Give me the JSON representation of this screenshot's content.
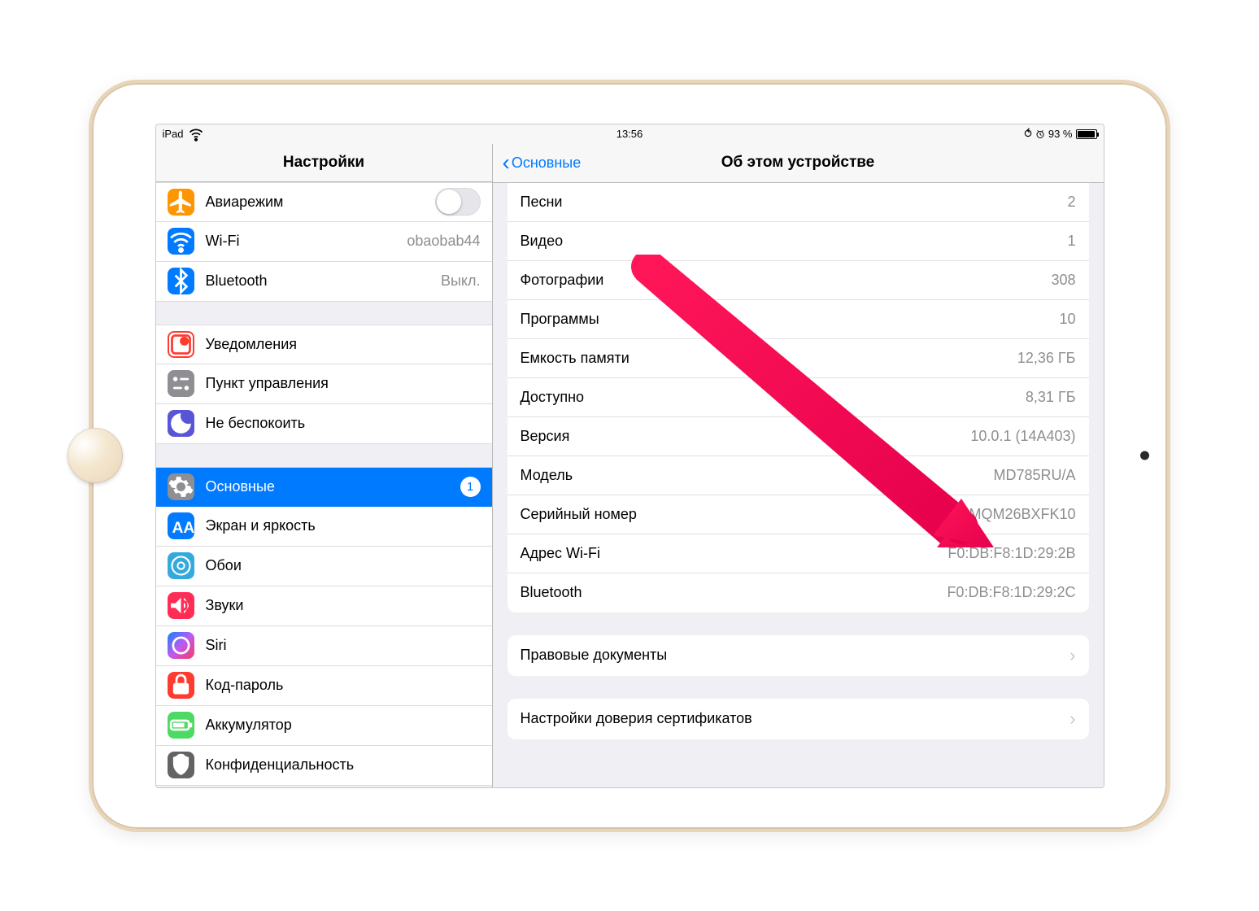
{
  "status": {
    "carrier": "iPad",
    "time": "13:56",
    "battery_text": "93 %",
    "lock_icon": "⟳",
    "alarm_icon": "●"
  },
  "sidebar": {
    "title": "Настройки",
    "groups": [
      [
        {
          "id": "airplane",
          "label": "Авиарежим",
          "icon_bg": "bg-orange",
          "has_toggle": true
        },
        {
          "id": "wifi",
          "label": "Wi-Fi",
          "value": "obaobab44",
          "icon_bg": "bg-blue"
        },
        {
          "id": "bluetooth",
          "label": "Bluetooth",
          "value": "Выкл.",
          "icon_bg": "bg-blue"
        }
      ],
      [
        {
          "id": "notifications",
          "label": "Уведомления",
          "icon_bg": "bg-white-outline"
        },
        {
          "id": "controlcenter",
          "label": "Пункт управления",
          "icon_bg": "bg-gray"
        },
        {
          "id": "dnd",
          "label": "Не беспокоить",
          "icon_bg": "bg-purple"
        }
      ],
      [
        {
          "id": "general",
          "label": "Основные",
          "icon_bg": "bg-gray",
          "selected": true,
          "badge": "1"
        },
        {
          "id": "display",
          "label": "Экран и яркость",
          "icon_bg": "bg-blue"
        },
        {
          "id": "wallpaper",
          "label": "Обои",
          "icon_bg": "bg-cyan"
        },
        {
          "id": "sounds",
          "label": "Звуки",
          "icon_bg": "bg-pink"
        },
        {
          "id": "siri",
          "label": "Siri",
          "icon_bg": "bg-siri"
        },
        {
          "id": "passcode",
          "label": "Код-пароль",
          "icon_bg": "bg-red"
        },
        {
          "id": "battery",
          "label": "Аккумулятор",
          "icon_bg": "bg-green"
        },
        {
          "id": "privacy",
          "label": "Конфиденциальность",
          "icon_bg": "bg-darkgray"
        }
      ]
    ]
  },
  "detail": {
    "back_label": "Основные",
    "title": "Об этом устройстве",
    "groups": [
      {
        "rows": [
          {
            "label": "Песни",
            "value": "2"
          },
          {
            "label": "Видео",
            "value": "1"
          },
          {
            "label": "Фотографии",
            "value": "308"
          },
          {
            "label": "Программы",
            "value": "10"
          },
          {
            "label": "Емкость памяти",
            "value": "12,36 ГБ"
          },
          {
            "label": "Доступно",
            "value": "8,31 ГБ"
          },
          {
            "label": "Версия",
            "value": "10.0.1 (14A403)"
          },
          {
            "label": "Модель",
            "value": "MD785RU/A"
          },
          {
            "label": "Серийный номер",
            "value": "DMQM26BXFK10"
          },
          {
            "label": "Адрес Wi-Fi",
            "value": "F0:DB:F8:1D:29:2B"
          },
          {
            "label": "Bluetooth",
            "value": "F0:DB:F8:1D:29:2C"
          }
        ]
      },
      {
        "rows": [
          {
            "label": "Правовые документы",
            "chevron": true
          }
        ]
      },
      {
        "rows": [
          {
            "label": "Настройки доверия сертификатов",
            "chevron": true
          }
        ]
      }
    ]
  },
  "annotation": {
    "arrow_color": "#ff1659"
  }
}
